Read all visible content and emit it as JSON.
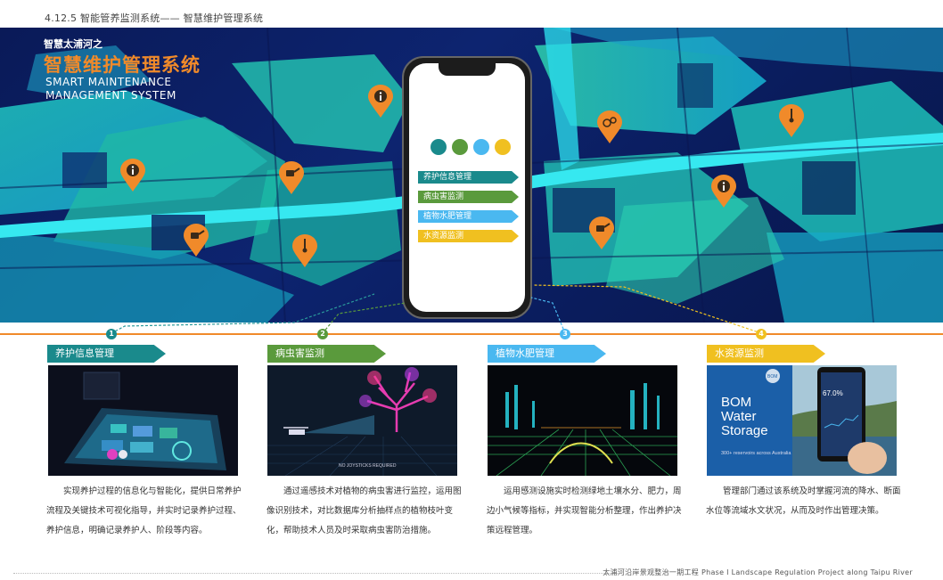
{
  "page": {
    "section_title": "4.12.5 智能管养监测系统—— 智慧维护管理系统",
    "footer": "太浦河沿岸景观整治一期工程  Phase Ⅰ Landscape Regulation Project along Taipu River"
  },
  "hero": {
    "subtitle": "智慧太浦河之",
    "title": "智慧维护管理系统",
    "title_en_line1": "SMART MAINTENANCE",
    "title_en_line2": "MANAGEMENT SYSTEM",
    "accent_color": "#f08a2a"
  },
  "phone": {
    "dot_colors": [
      "#1a8a8c",
      "#5a9a3c",
      "#4ab8f0",
      "#f0c020"
    ],
    "menu": [
      {
        "label": "养护信息管理",
        "color": "#1a8a8c"
      },
      {
        "label": "病虫害监测",
        "color": "#5a9a3c"
      },
      {
        "label": "植物水肥管理",
        "color": "#4ab8f0"
      },
      {
        "label": "水资源监测",
        "color": "#f0c020"
      }
    ]
  },
  "pins": [
    {
      "icon": "info-icon"
    },
    {
      "icon": "watering-can-icon"
    },
    {
      "icon": "info-icon"
    },
    {
      "icon": "watering-can-icon"
    },
    {
      "icon": "thermometer-icon"
    },
    {
      "icon": "sensor-icon"
    },
    {
      "icon": "watering-can-icon"
    },
    {
      "icon": "info-icon"
    },
    {
      "icon": "thermometer-icon"
    }
  ],
  "panels": [
    {
      "number": "1",
      "label": "养护信息管理",
      "color": "#1a8a8c",
      "description": "实现养护过程的信息化与智能化，提供日常养护流程及关键技术可视化指导，并实时记录养护过程、养护信息，明确记录养护人、阶段等内容。"
    },
    {
      "number": "2",
      "label": "病虫害监测",
      "color": "#5a9a3c",
      "description": "通过遥感技术对植物的病虫害进行监控，运用图像识别技术，对比数据库分析抽样点的植物枝叶变化，帮助技术人员及时采取病虫害防治措施。",
      "photo_caption": "NO JOYSTICKS REQUIRED"
    },
    {
      "number": "3",
      "label": "植物水肥管理",
      "color": "#4ab8f0",
      "description": "运用感测设施实时检测绿地土壤水分、肥力，周边小气候等指标，并实现智能分析整理，作出养护决策远程管理。"
    },
    {
      "number": "4",
      "label": "水资源监测",
      "color": "#f0c020",
      "description": "管理部门通过该系统及时掌握河流的降水、断面水位等流域水文状况，从而及时作出管理决策。",
      "photo_title_lines": [
        "BOM",
        "Water",
        "Storage"
      ],
      "photo_subtitle": "300+ reservoirs across Australia",
      "photo_badge": "BOM",
      "photo_percent": "67.0%"
    }
  ]
}
